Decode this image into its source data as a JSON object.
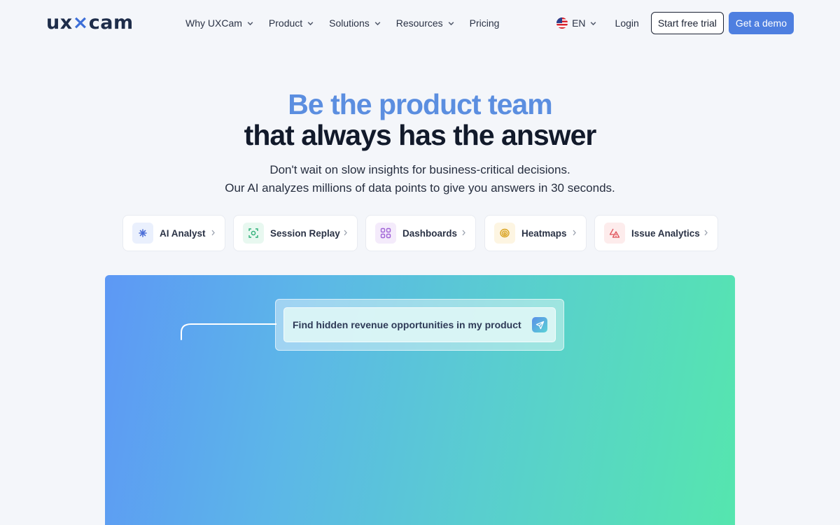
{
  "brand": {
    "logo_pre": "ux",
    "logo_x": "",
    "logo_post": "cam"
  },
  "nav": {
    "menu": [
      {
        "label": "Why UXCam"
      },
      {
        "label": "Product"
      },
      {
        "label": "Solutions"
      },
      {
        "label": "Resources"
      },
      {
        "label": "Pricing"
      }
    ],
    "language": "EN",
    "login": "Login",
    "trial_button": "Start free trial",
    "demo_button": "Get a demo"
  },
  "hero": {
    "title_line1": "Be the product team",
    "title_line2": "that always has the answer",
    "subtitle_line1": "Don't wait on slow insights for business-critical decisions.",
    "subtitle_line2": "Our AI analyzes millions of data points to give you answers in 30 seconds."
  },
  "features": [
    {
      "label": "AI Analyst",
      "icon": "sparkle-icon",
      "color": "#4d6fd8",
      "bg": "#eaf0fd"
    },
    {
      "label": "Session Replay",
      "icon": "focus-icon",
      "color": "#2faf78",
      "bg": "#e8f8f0"
    },
    {
      "label": "Dashboards",
      "icon": "grid-icon",
      "color": "#a063d6",
      "bg": "#f4ebfb"
    },
    {
      "label": "Heatmaps",
      "icon": "heatmap-icon",
      "color": "#d9a21f",
      "bg": "#fdf5e2"
    },
    {
      "label": "Issue Analytics",
      "icon": "warning-icon",
      "color": "#e0525a",
      "bg": "#fdecec"
    }
  ],
  "demo": {
    "prompt": "Find hidden revenue opportunities in my product"
  },
  "colors": {
    "accent": "#4e7fe0",
    "title_blue": "#5b8ee0",
    "dark": "#121a2b"
  }
}
